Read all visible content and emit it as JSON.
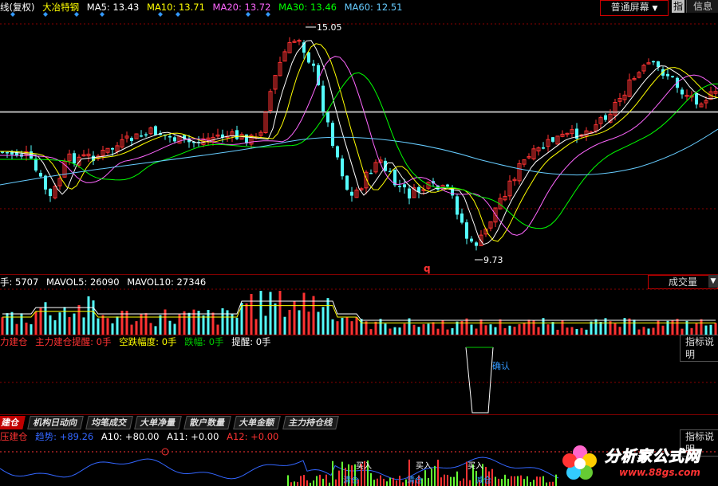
{
  "title_bar": {
    "prefix": "线(复权)",
    "stock_name": "大冶特钢",
    "ma": [
      {
        "label": "MA5: 13.43",
        "color": "#ffffff"
      },
      {
        "label": "MA10: 13.71",
        "color": "#ffff00"
      },
      {
        "label": "MA20: 13.72",
        "color": "#ff66ff"
      },
      {
        "label": "MA30: 13.46",
        "color": "#00ff00"
      },
      {
        "label": "MA60: 12.51",
        "color": "#66ccff"
      }
    ],
    "screen_button": "普通屏幕",
    "tab_index": "指",
    "tab_info": "信息"
  },
  "main_chart": {
    "high_label": "15.05",
    "low_label": "9.73",
    "marker_q": "q"
  },
  "volume_panel": {
    "legend": [
      {
        "label": "手: 5707",
        "color": "#ffffff"
      },
      {
        "label": "MAVOL5: 26090",
        "color": "#ffffff"
      },
      {
        "label": "MAVOL10: 27346",
        "color": "#ffffff"
      }
    ],
    "dropdown": "成交量"
  },
  "indicator_panel": {
    "legend": [
      {
        "label": "力建仓",
        "color": "#ff3333"
      },
      {
        "label": "主力建仓提醒: 0手",
        "color": "#ff3333"
      },
      {
        "label": "空跌幅度: 0手",
        "color": "#ffff00"
      },
      {
        "label": "跌幅: 0手",
        "color": "#00cc00"
      },
      {
        "label": "提醒: 0手",
        "color": "#ffffff"
      }
    ],
    "confirm_label": "确认",
    "help": "指标说明"
  },
  "bottom_tabs": [
    "建仓",
    "机构日动向",
    "均笔成交",
    "大单净量",
    "散户数量",
    "大单金额",
    "主力持仓线"
  ],
  "bottom_panel": {
    "legend": [
      {
        "label": "压建仓",
        "color": "#ff3333"
      },
      {
        "label": "趋势: +89.26",
        "color": "#3366ff"
      },
      {
        "label": "A10: +80.00",
        "color": "#ffffff"
      },
      {
        "label": "A11: +0.00",
        "color": "#ffffff"
      },
      {
        "label": "A12: +0.00",
        "color": "#ff3333"
      }
    ],
    "help": "指标说明",
    "labels": [
      "买入",
      "买入",
      "买入",
      "清仓",
      "清仓",
      "减仓"
    ]
  },
  "watermark": {
    "title": "分析家公式网",
    "url": "www.88gs.com"
  },
  "colors": {
    "up": "#ff3232",
    "down": "#54fcfc",
    "panel_border": "#800000"
  }
}
